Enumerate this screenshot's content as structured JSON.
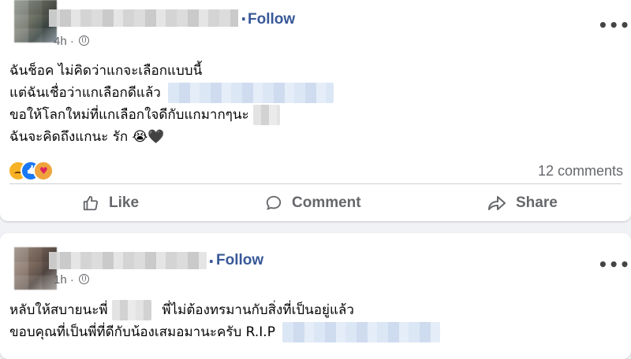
{
  "posts": [
    {
      "follow_label": "Follow",
      "separator": "·",
      "time": "4h",
      "more": "•••",
      "lines": [
        "ฉันช็อค ไม่คิดว่าแกจะเลือกแบบนี้",
        "แต่ฉันเชื่อว่าแกเลือกดีแล้ว",
        "ขอให้โลกใหม่ที่แกเลือกใจดีกับแกมากๆนะ",
        "ฉันจะคิดถึงแกนะ รัก"
      ],
      "line4_emoji": "😭🖤",
      "reactions": [
        "sad-reaction-icon",
        "like-reaction-icon",
        "care-reaction-icon"
      ],
      "comments_count": "12 comments",
      "actions": {
        "like": "Like",
        "comment": "Comment",
        "share": "Share"
      }
    },
    {
      "follow_label": "Follow",
      "separator": "·",
      "time": "1h",
      "more": "•••",
      "lines": [
        "หลับให้สบายนะพี่",
        "พี่ไม่ต้องทรมานกับสิ่งที่เป็นอยู่แล้ว",
        "ขอบคุณที่เป็นพี่ที่ดีกับน้องเสมอมานะครับ R.I.P"
      ]
    }
  ],
  "colors": {
    "link": "#385898",
    "muted": "#65676b",
    "background": "#f0f2f5"
  }
}
